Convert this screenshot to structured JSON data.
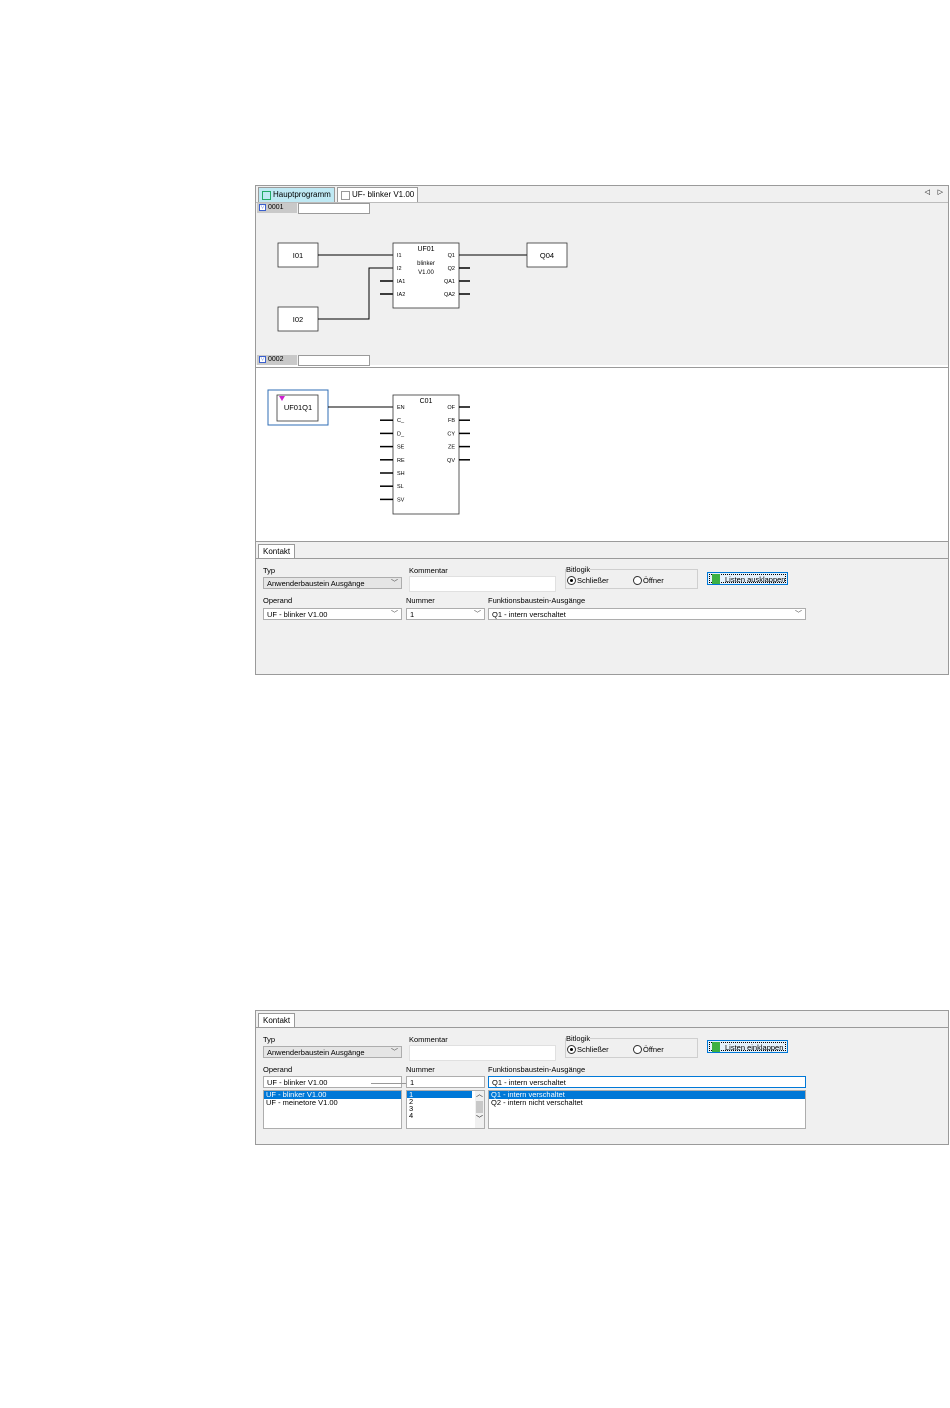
{
  "editor": {
    "tabs": [
      {
        "label": "Hauptprogramm"
      },
      {
        "label": "UF- blinker V1.00"
      }
    ],
    "nav_left": "◁",
    "nav_right": "▷",
    "networks": [
      {
        "label": "0001",
        "inputs": [
          "I01",
          "I02"
        ],
        "block": {
          "name": "UF01",
          "desc_line1": "blinker",
          "desc_line2": "V1.00",
          "left_pins": [
            "I1",
            "I2",
            "IA1",
            "IA2"
          ],
          "right_pins": [
            "Q1",
            "Q2",
            "QA1",
            "QA2"
          ]
        },
        "output": "Q04"
      },
      {
        "label": "0002",
        "contact": "UF01Q1",
        "block": {
          "name": "C01",
          "left_pins": [
            "EN",
            "C_",
            "D_",
            "SE",
            "RE",
            "SH",
            "SL",
            "SV"
          ],
          "right_pins": [
            "OF",
            "FB",
            "CY",
            "ZE",
            "QV"
          ]
        }
      }
    ]
  },
  "panel_top": {
    "tab": "Kontakt",
    "typ_label": "Typ",
    "typ_value": "Anwenderbaustein Ausgänge",
    "kommentar_label": "Kommentar",
    "bitlogik_label": "Bitlogik",
    "radio1": "Schließer",
    "radio2": "Öffner",
    "button": "Listen ausklappen",
    "operand_label": "Operand",
    "operand_value": "UF - blinker V1.00",
    "nummer_label": "Nummer",
    "nummer_value": "1",
    "fb_label": "Funktionsbaustein-Ausgänge",
    "fb_value": "Q1 - intern verschaltet"
  },
  "panel_bottom": {
    "tab": "Kontakt",
    "typ_label": "Typ",
    "typ_value": "Anwenderbaustein Ausgänge",
    "kommentar_label": "Kommentar",
    "bitlogik_label": "Bitlogik",
    "radio1": "Schließer",
    "radio2": "Öffner",
    "button": "Listen einklappen",
    "operand_label": "Operand",
    "operand_value": "UF - blinker V1.00",
    "operand_list": [
      "UF - blinker V1.00",
      "UF - meinetore V1.00"
    ],
    "nummer_label": "Nummer",
    "nummer_value": "1",
    "nummer_list": [
      "1",
      "2",
      "3",
      "4"
    ],
    "fb_label": "Funktionsbaustein-Ausgänge",
    "fb_value": "Q1 - intern verschaltet",
    "fb_list": [
      "Q1 - intern verschaltet",
      "Q2 - intern nicht verschaltet"
    ]
  }
}
